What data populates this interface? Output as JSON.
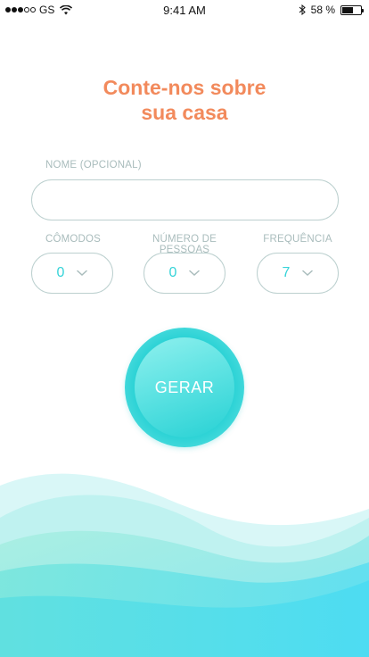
{
  "status_bar": {
    "carrier": "GS",
    "time": "9:41 AM",
    "battery_percent_text": "58 %",
    "battery_level": 0.58,
    "signal_bars_filled": 3,
    "signal_bars_total": 5
  },
  "title": {
    "line1": "Conte-nos sobre",
    "line2": "sua casa"
  },
  "name_field": {
    "label": "NOME (OPCIONAL)",
    "value": ""
  },
  "selects": {
    "rooms": {
      "label": "CÔMODOS",
      "value": "0"
    },
    "people": {
      "label": "NÚMERO DE PESSOAS",
      "value": "0"
    },
    "frequency": {
      "label": "FREQUÊNCIA",
      "value": "7"
    }
  },
  "generate_button": {
    "label": "GERAR"
  },
  "colors": {
    "title": "#f28a5c",
    "accent": "#36d3d8",
    "label": "#a9bcbc",
    "border": "#bcd0cf"
  }
}
